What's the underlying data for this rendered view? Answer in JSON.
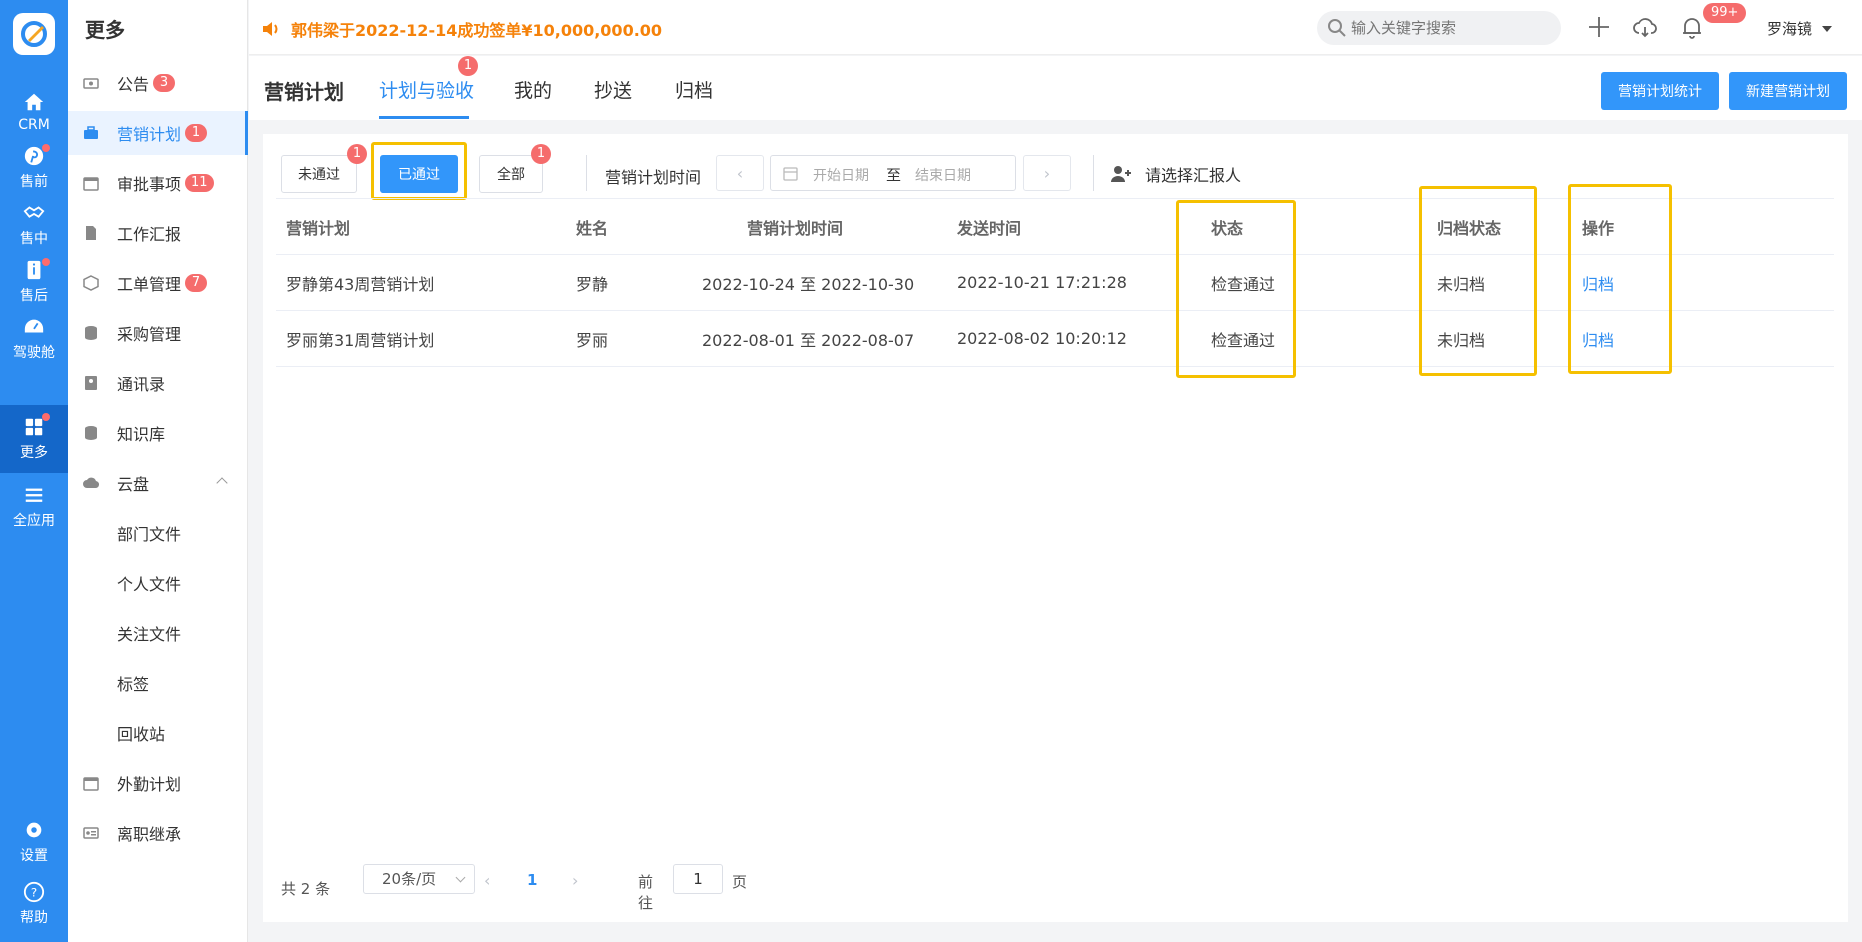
{
  "rail": {
    "items": [
      {
        "label": "CRM",
        "icon": "home-icon"
      },
      {
        "label": "售前",
        "icon": "pinterest-icon"
      },
      {
        "label": "售中",
        "icon": "handshake-icon"
      },
      {
        "label": "售后",
        "icon": "info-icon"
      },
      {
        "label": "驾驶舱",
        "icon": "dashboard-icon"
      },
      {
        "label": "更多",
        "icon": "grid-icon"
      },
      {
        "label": "全应用",
        "icon": "menu-icon"
      },
      {
        "label": "设置",
        "icon": "gear-icon"
      },
      {
        "label": "帮助",
        "icon": "help-icon"
      }
    ]
  },
  "sidebar": {
    "title": "更多",
    "items": [
      {
        "label": "公告",
        "badge": "3"
      },
      {
        "label": "营销计划",
        "badge": "1"
      },
      {
        "label": "审批事项",
        "badge": "11"
      },
      {
        "label": "工作汇报"
      },
      {
        "label": "工单管理",
        "badge": "7"
      },
      {
        "label": "采购管理"
      },
      {
        "label": "通讯录"
      },
      {
        "label": "知识库"
      },
      {
        "label": "云盘"
      },
      {
        "label": "部门文件"
      },
      {
        "label": "个人文件"
      },
      {
        "label": "关注文件"
      },
      {
        "label": "标签"
      },
      {
        "label": "回收站"
      },
      {
        "label": "外勤计划"
      },
      {
        "label": "离职继承"
      }
    ]
  },
  "topbar": {
    "notice": "郭伟梁于2022-12-14成功签单¥10,000,000.00",
    "search_placeholder": "输入关键字搜索",
    "bell_badge": "99+",
    "user_name": "罗海镜"
  },
  "header": {
    "title": "营销计划",
    "tabs": [
      "计划与验收",
      "我的",
      "抄送",
      "归档"
    ],
    "tab_badge": "1",
    "btn_stats": "营销计划统计",
    "btn_new": "新建营销计划"
  },
  "filters": {
    "not_passed": "未通过",
    "not_passed_badge": "1",
    "passed": "已通过",
    "all": "全部",
    "all_badge": "1",
    "date_label": "营销计划时间",
    "start_placeholder": "开始日期",
    "to": "至",
    "end_placeholder": "结束日期",
    "reporter": "请选择汇报人"
  },
  "table": {
    "headers": [
      "营销计划",
      "姓名",
      "营销计划时间",
      "发送时间",
      "状态",
      "归档状态",
      "操作"
    ],
    "rows": [
      {
        "plan": "罗静第43周营销计划",
        "name": "罗静",
        "period": "2022-10-24 至 2022-10-30",
        "sent": "2022-10-21 17:21:28",
        "status": "检查通过",
        "archive": "未归档",
        "action": "归档"
      },
      {
        "plan": "罗丽第31周营销计划",
        "name": "罗丽",
        "period": "2022-08-01 至 2022-08-07",
        "sent": "2022-08-02 10:20:12",
        "status": "检查通过",
        "archive": "未归档",
        "action": "归档"
      }
    ]
  },
  "pagination": {
    "total": "共 2 条",
    "page_size": "20条/页",
    "current": "1",
    "goto": "前往",
    "goto_value": "1",
    "page_word": "页"
  },
  "colors": {
    "primary": "#2d8cf0",
    "highlight": "#f5c000",
    "badge": "#f56c6c",
    "notice": "#f5820a"
  }
}
